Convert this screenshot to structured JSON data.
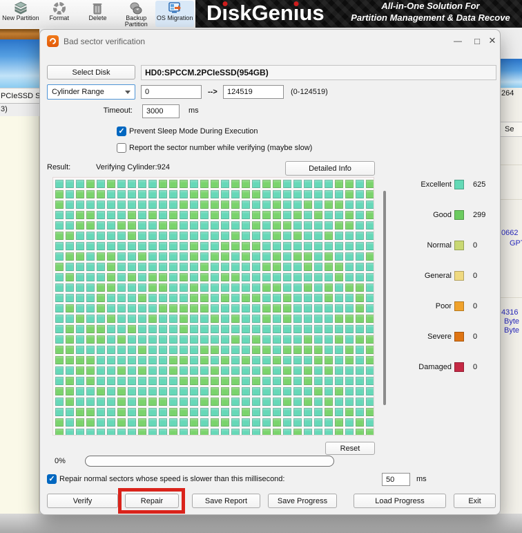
{
  "toolbar": {
    "items": [
      {
        "label": "New Partition",
        "icon": "new-partition"
      },
      {
        "label": "Format",
        "icon": "format"
      },
      {
        "label": "Delete",
        "icon": "delete"
      },
      {
        "label": "Backup Partition",
        "icon": "backup-partition"
      },
      {
        "label": "OS Migration",
        "icon": "os-migration"
      }
    ],
    "brand": "DiskGenius",
    "slogan_line1": "All-in-One Solution For",
    "slogan_line2": "Partition Management & Data Recove"
  },
  "background": {
    "left_disk_label": "PCIeSSD  S",
    "left_fragment": "3)",
    "right_number": "264",
    "right_header": "Se",
    "right_fragment_1": "0662",
    "right_fragment_2": "GPT",
    "right_fragment_3": "4316",
    "right_fragment_4": "Byte",
    "right_fragment_5": "Byte"
  },
  "dialog": {
    "title": "Bad sector verification",
    "window_controls": {
      "minimize": "—",
      "maximize": "□",
      "close": "✕"
    },
    "select_disk_label": "Select Disk",
    "disk_value": "HD0:SPCCM.2PCIeSSD(954GB)",
    "range_mode": "Cylinder Range",
    "range_from": "0",
    "range_arrow": "-->",
    "range_to": "124519",
    "range_hint": "(0-124519)",
    "timeout_label": "Timeout:",
    "timeout_value": "3000",
    "timeout_unit": "ms",
    "prevent_sleep_label": "Prevent Sleep Mode During Execution",
    "prevent_sleep_checked": true,
    "report_sector_label": "Report the sector number while verifying (maybe slow)",
    "report_sector_checked": false,
    "result_label": "Result:",
    "result_status": "Verifying Cylinder:924",
    "detailed_info_label": "Detailed Info",
    "legend": [
      {
        "name": "Excellent",
        "count": 625,
        "color": "#63d9b6"
      },
      {
        "name": "Good",
        "count": 299,
        "color": "#6ccb60"
      },
      {
        "name": "Normal",
        "count": 0,
        "color": "#c9d873"
      },
      {
        "name": "General",
        "count": 0,
        "color": "#efd980"
      },
      {
        "name": "Poor",
        "count": 0,
        "color": "#f0a22c"
      },
      {
        "name": "Severe",
        "count": 0,
        "color": "#df7514"
      },
      {
        "name": "Damaged",
        "count": 0,
        "color": "#c52944"
      }
    ],
    "grid": {
      "cols": 31,
      "rows": 25,
      "excellent_color": "#66d8b8",
      "good_color": "#7ad36c",
      "good_ratio": 0.3236,
      "seed": 20
    },
    "reset_label": "Reset",
    "progress_percent": "0%",
    "repair_checkbox_label": "Repair normal sectors whose speed is slower than this millisecond:",
    "repair_checkbox_checked": true,
    "repair_threshold": "50",
    "repair_unit": "ms",
    "buttons": [
      {
        "label": "Verify"
      },
      {
        "label": "Repair"
      },
      {
        "label": "Save Report"
      },
      {
        "label": "Save Progress"
      },
      {
        "label": "Load Progress"
      },
      {
        "label": "Exit"
      }
    ]
  }
}
